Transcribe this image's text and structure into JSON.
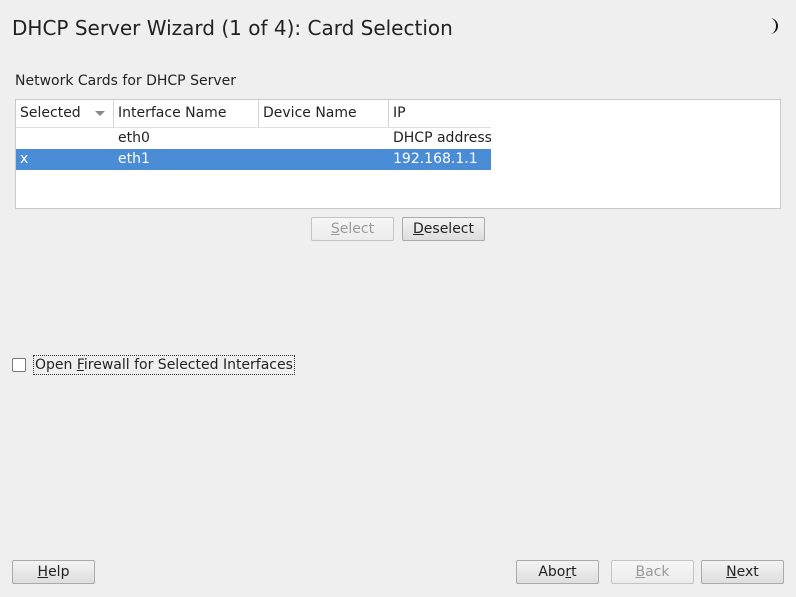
{
  "window": {
    "title": "DHCP Server Wizard (1 of 4): Card Selection"
  },
  "icons": {
    "theme_toggle": "crescent-moon-icon",
    "sort_indicator": "triangle-down-icon"
  },
  "network": {
    "group_label": "Network Cards for DHCP Server",
    "columns": [
      "Selected",
      "Interface Name",
      "Device Name",
      "IP"
    ],
    "rows": [
      {
        "selected": "",
        "interface": "eth0",
        "device": "",
        "ip": "DHCP address"
      },
      {
        "selected": "x",
        "interface": "eth1",
        "device": "",
        "ip": "192.168.1.1"
      }
    ],
    "selected_row": 1,
    "select_btn": {
      "mnemonic": "S",
      "rest": "elect",
      "enabled": false
    },
    "deselect_btn": {
      "mnemonic": "D",
      "rest": "eselect",
      "enabled": true
    }
  },
  "firewall": {
    "checked": false,
    "label_pre": "Open ",
    "label_mnemonic": "F",
    "label_rest": "irewall for Selected Interfaces"
  },
  "footer": {
    "help": {
      "mnemonic": "H",
      "rest": "elp"
    },
    "abort": {
      "pre": "Abo",
      "mnemonic": "r",
      "rest": "t"
    },
    "back": {
      "mnemonic": "B",
      "rest": "ack",
      "enabled": false
    },
    "next": {
      "mnemonic": "N",
      "rest": "ext"
    }
  },
  "colors": {
    "selection": "#4a8cd6",
    "background": "#efefef"
  }
}
